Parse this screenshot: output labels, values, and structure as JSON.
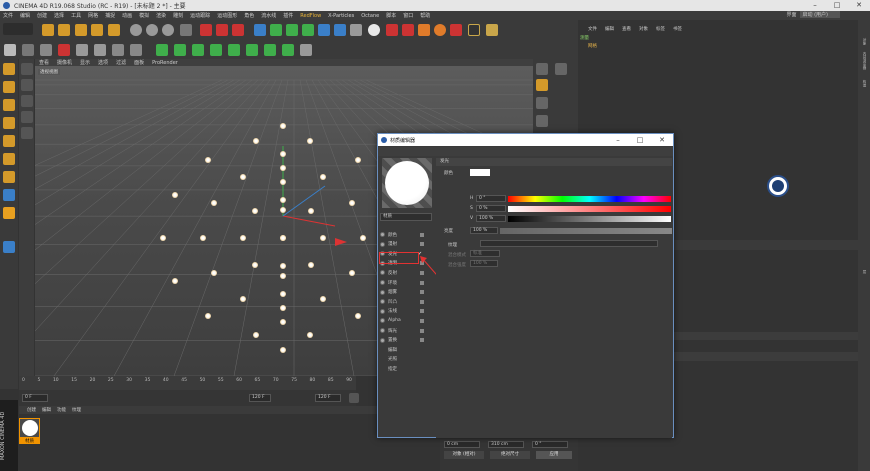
{
  "window": {
    "title": "CINEMA 4D R19.068 Studio (RC - R19) - [未标题 2 *] - 主要"
  },
  "menubar": {
    "items": [
      "文件",
      "编辑",
      "创建",
      "选择",
      "工具",
      "网格",
      "捕捉",
      "动画",
      "模拟",
      "渲染",
      "雕刻",
      "运动跟踪",
      "运动图形",
      "角色",
      "流水线",
      "插件"
    ],
    "redflow": "RedFlow",
    "rest": [
      "X-Particles",
      "Octane",
      "脚本",
      "窗口",
      "帮助"
    ]
  },
  "layout": {
    "label": "界面",
    "value": "启动 (用户)"
  },
  "viewport": {
    "menu": [
      "查看",
      "摄像机",
      "显示",
      "选项",
      "过滤",
      "面板",
      "ProRender"
    ],
    "label": "透视视图"
  },
  "timeline": {
    "ticks": [
      "0",
      "5",
      "10",
      "15",
      "20",
      "25",
      "30",
      "35",
      "40",
      "45",
      "50",
      "55",
      "60",
      "65",
      "70",
      "75",
      "80",
      "85",
      "90"
    ],
    "frame_start": "0 F",
    "frame_end": "120 F",
    "frame_current": "120 F"
  },
  "material_manager": {
    "menu": [
      "创建",
      "编辑",
      "功能",
      "纹理"
    ],
    "material_name": "材质",
    "brand": "MAXON CINEMA 4D"
  },
  "object_manager": {
    "menu": [
      "文件",
      "编辑",
      "查看",
      "对象",
      "标签",
      "书签"
    ],
    "objects": [
      "测量",
      "网格"
    ]
  },
  "right_strip": [
    "对象",
    "内容浏览器",
    "构造",
    "层"
  ],
  "attributes": {
    "tabs_row": "模式"
  },
  "coords": {
    "x": "0 cm",
    "y": "310 cm",
    "b": "0 °",
    "mode1": "对象 (相对)",
    "mode2": "绝对尺寸",
    "apply": "应用"
  },
  "material_editor": {
    "title": "材质编辑器",
    "name": "材质",
    "channels": [
      {
        "name": "颜色",
        "on": true
      },
      {
        "name": "漫射",
        "on": false
      },
      {
        "name": "发光",
        "on": true
      },
      {
        "name": "透明",
        "on": false
      },
      {
        "name": "反射",
        "on": true
      },
      {
        "name": "环境",
        "on": false
      },
      {
        "name": "烟雾",
        "on": false
      },
      {
        "name": "凹凸",
        "on": false
      },
      {
        "name": "法线",
        "on": false
      },
      {
        "name": "Alpha",
        "on": false
      },
      {
        "name": "辉光",
        "on": false
      },
      {
        "name": "置换",
        "on": false
      },
      {
        "name": "编辑",
        "on": false
      },
      {
        "name": "光照",
        "on": false
      },
      {
        "name": "指定",
        "on": false
      }
    ],
    "section": "发光",
    "color_label": "颜色",
    "h_label": "H",
    "h_value": "0 °",
    "s_label": "S",
    "s_value": "0 %",
    "v_label": "V",
    "v_value": "100 %",
    "brightness_label": "亮度",
    "brightness_value": "100 %",
    "texture_label": "纹理",
    "mix_mode_label": "混合模式",
    "mix_mode_value": "标准",
    "mix_strength_label": "混合强度",
    "mix_strength_value": "100 %",
    "check": "✔"
  }
}
